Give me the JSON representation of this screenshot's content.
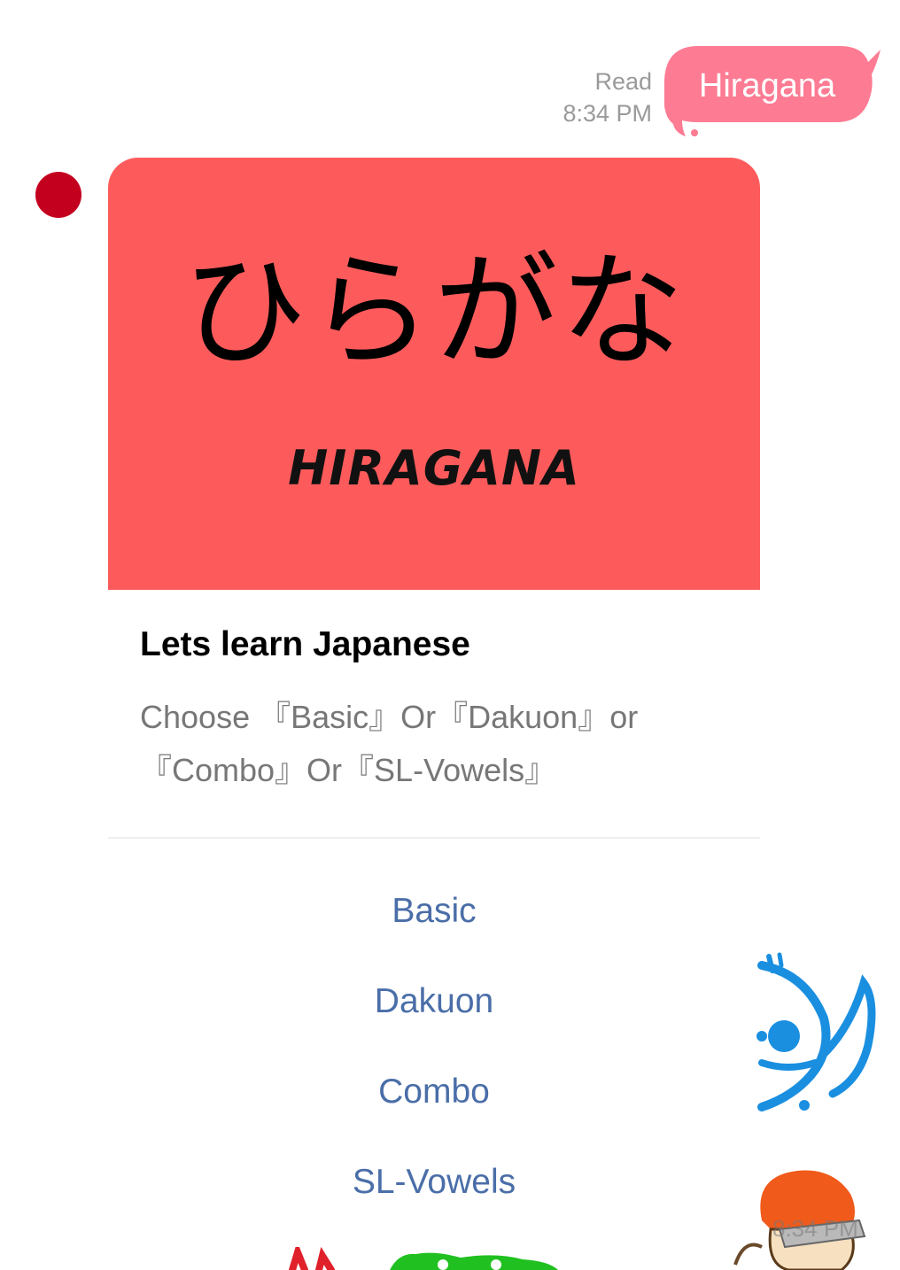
{
  "outgoing": {
    "message": "Hiragana",
    "status": "Read",
    "time": "8:34 PM",
    "bubble_color": "#fd7b93"
  },
  "bot": {
    "avatar_color": "#c4001f"
  },
  "card": {
    "image": {
      "kana": "ひらがな",
      "romaji": "HIRAGANA",
      "background_color": "#fd5b5b"
    },
    "title": "Lets learn Japanese",
    "subtitle": "Choose 『Basic』Or『Dakuon』or 『Combo』Or『SL-Vowels』",
    "buttons": [
      {
        "label": "Basic"
      },
      {
        "label": "Dakuon"
      },
      {
        "label": "Combo"
      },
      {
        "label": "SL-Vowels"
      }
    ],
    "button_color": "#4a6ea8"
  },
  "stickers": {
    "partial_time": "8:34 PM"
  }
}
